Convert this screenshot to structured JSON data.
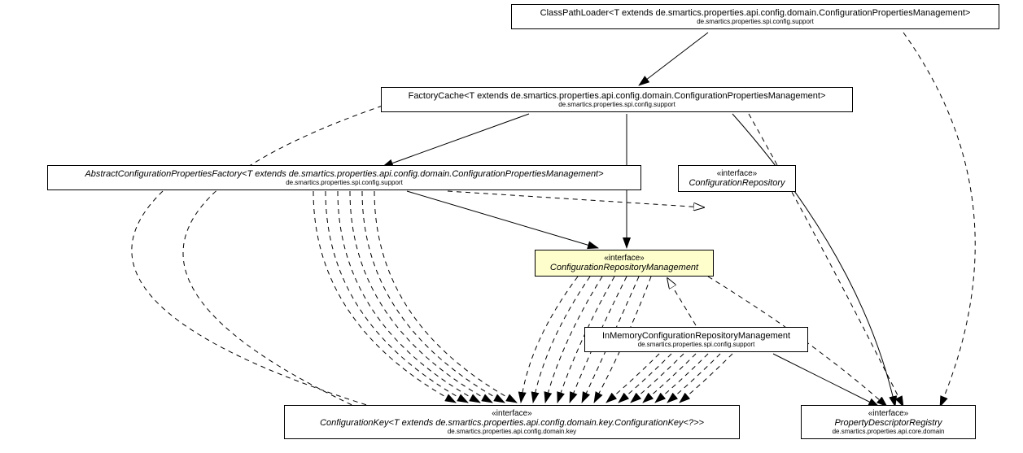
{
  "nodes": {
    "classPathLoader": {
      "title": "ClassPathLoader<T extends de.smartics.properties.api.config.domain.ConfigurationPropertiesManagement>",
      "package": "de.smartics.properties.spi.config.support"
    },
    "factoryCache": {
      "title": "FactoryCache<T extends de.smartics.properties.api.config.domain.ConfigurationPropertiesManagement>",
      "package": "de.smartics.properties.spi.config.support"
    },
    "abstractFactory": {
      "title": "AbstractConfigurationPropertiesFactory<T extends de.smartics.properties.api.config.domain.ConfigurationPropertiesManagement>",
      "package": "de.smartics.properties.spi.config.support"
    },
    "configRepo": {
      "stereotype": "«interface»",
      "title": "ConfigurationRepository"
    },
    "configRepoMgmt": {
      "stereotype": "«interface»",
      "title": "ConfigurationRepositoryManagement"
    },
    "inMemory": {
      "title": "InMemoryConfigurationRepositoryManagement",
      "package": "de.smartics.properties.spi.config.support"
    },
    "configKey": {
      "stereotype": "«interface»",
      "title": "ConfigurationKey<T extends de.smartics.properties.api.config.domain.key.ConfigurationKey<?>>",
      "package": "de.smartics.properties.api.config.domain.key"
    },
    "propDescReg": {
      "stereotype": "«interface»",
      "title": "PropertyDescriptorRegistry",
      "package": "de.smartics.properties.api.core.domain"
    }
  }
}
